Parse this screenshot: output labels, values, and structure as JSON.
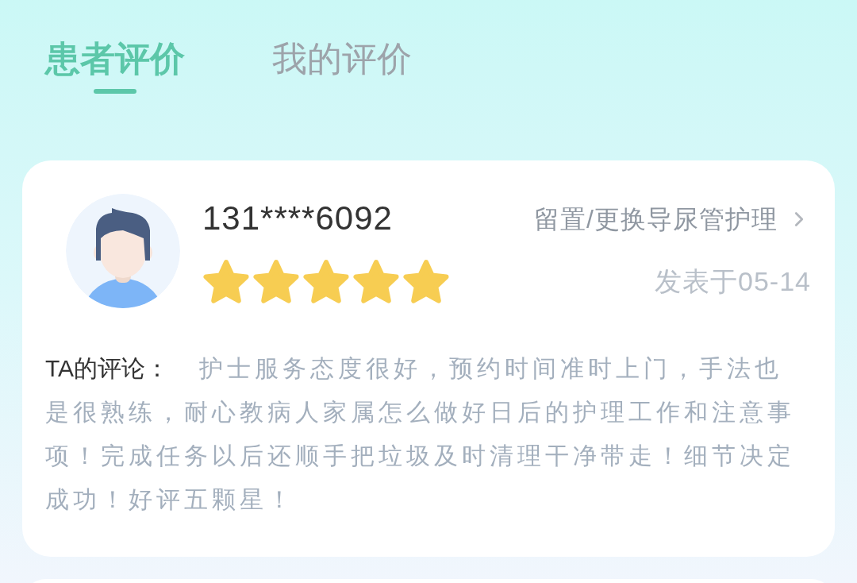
{
  "tabs": [
    {
      "label": "患者评价",
      "selected": true
    },
    {
      "label": "我的评价",
      "selected": false
    }
  ],
  "reviews": [
    {
      "user": "131****6092",
      "stars": 5,
      "service": "留置/更换导尿管护理",
      "date": "发表于05-14",
      "comment_label": "TA的评论：",
      "comment": "护士服务态度很好，预约时间准时上门，手法也是很熟练，耐心教病人家属怎么做好日后的护理工作和注意事项！完成任务以后还顺手把垃圾及时清理干净带走！细节决定成功！好评五颗星！"
    }
  ]
}
